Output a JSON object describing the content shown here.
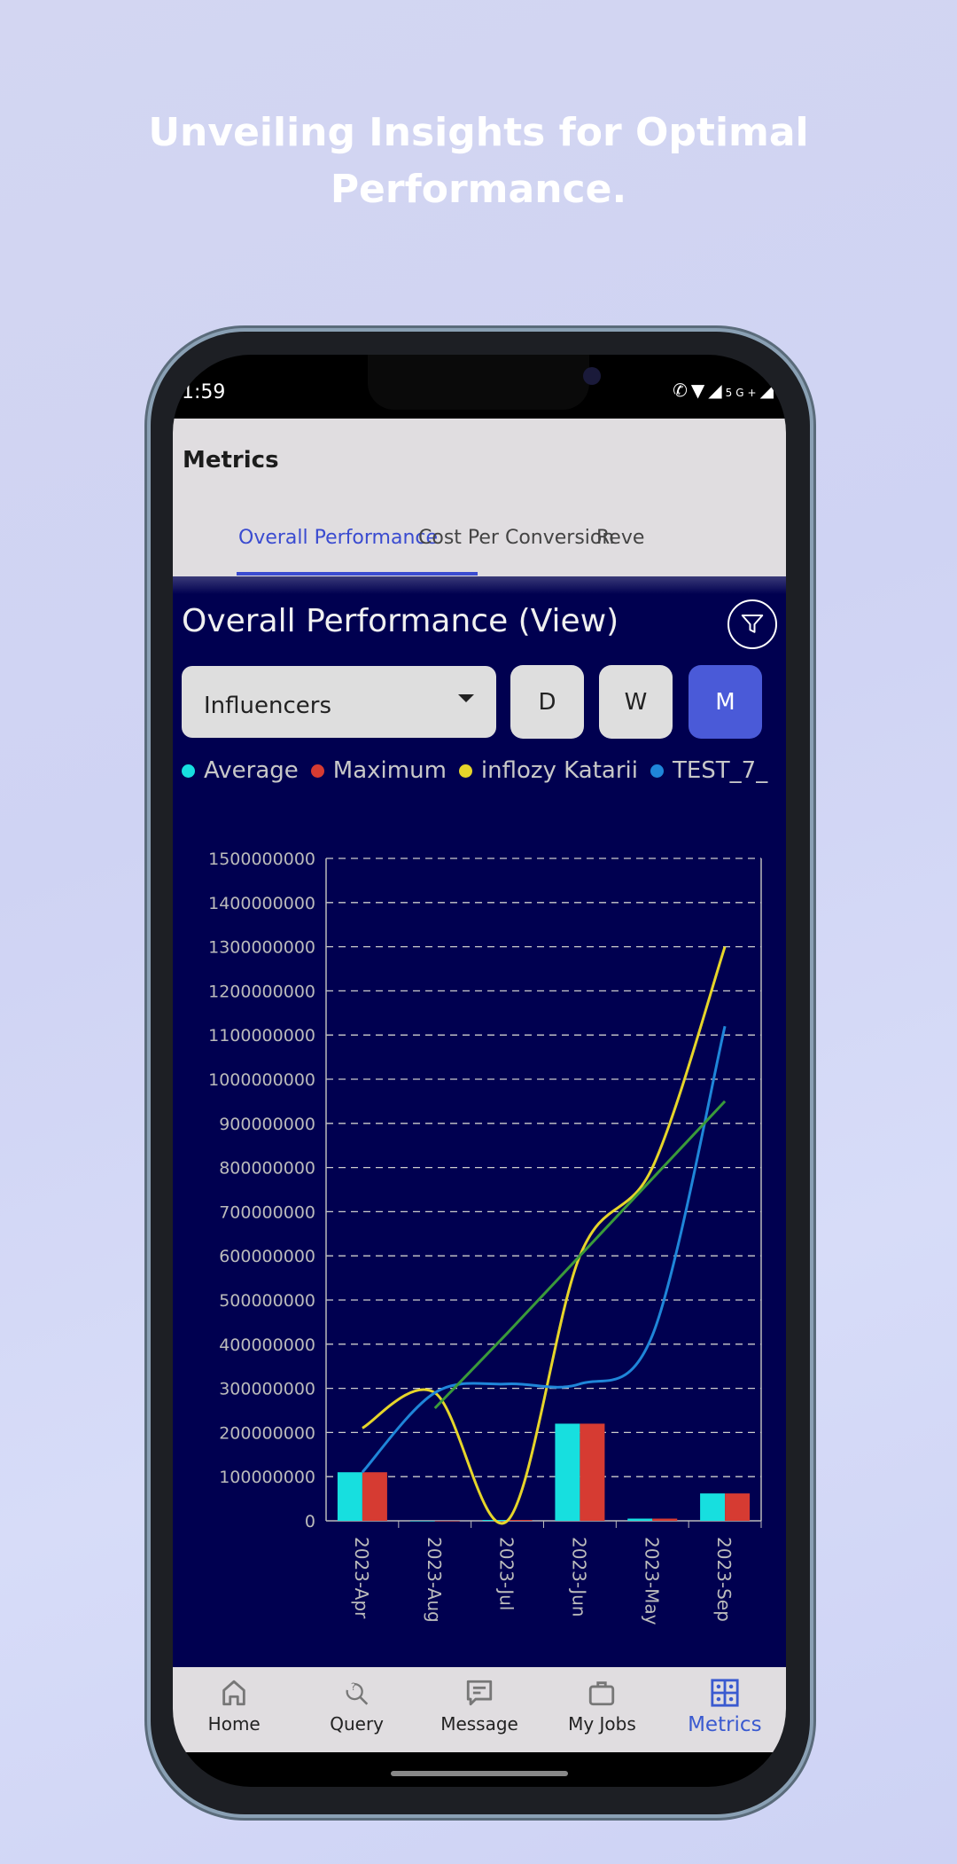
{
  "headline": {
    "line1": "Unveiling Insights for Optimal",
    "line2": "Performance."
  },
  "status": {
    "time": "1:59",
    "icons": [
      "wifi-call-icon",
      "wifi-icon",
      "signal-icon",
      "5g-icon",
      "signal-icon"
    ],
    "network": "5G+"
  },
  "appbar": {
    "title": "Metrics",
    "tabs": [
      {
        "label": "Overall Performance",
        "active": true
      },
      {
        "label": "Cost Per Conversion"
      },
      {
        "label": "Reve"
      }
    ]
  },
  "content": {
    "title": "Overall Performance (View)",
    "filter_icon": "filter-icon",
    "dropdown": {
      "value": "Influencers"
    },
    "periods": [
      {
        "label": "D"
      },
      {
        "label": "W"
      },
      {
        "label": "M",
        "active": true
      }
    ]
  },
  "colors": {
    "accent": "#4a5ad8",
    "background": "#000050",
    "average": "#17dfdf",
    "maximum": "#d63b32",
    "inflozy": "#e6d52a",
    "test": "#1f86d9",
    "trend": "#3a9a3a"
  },
  "chart_data": {
    "type": "bar+line",
    "categories": [
      "2023-Apr",
      "2023-Aug",
      "2023-Jul",
      "2023-Jun",
      "2023-May",
      "2023-Sep"
    ],
    "ylim": [
      0,
      1500000000
    ],
    "yticks": [
      "0",
      "100000000",
      "200000000",
      "300000000",
      "400000000",
      "500000000",
      "600000000",
      "700000000",
      "800000000",
      "900000000",
      "1000000000",
      "1100000000",
      "1200000000",
      "1300000000",
      "1400000000",
      "1500000000"
    ],
    "grid": "horizontal dashed",
    "legend": "top",
    "series": [
      {
        "name": "Average",
        "type": "bar",
        "color": "#17dfdf",
        "values": [
          110000000,
          0,
          2000000,
          220000000,
          5000000,
          62000000
        ]
      },
      {
        "name": "Maximum",
        "type": "bar",
        "color": "#d63b32",
        "values": [
          110000000,
          0,
          2000000,
          220000000,
          5000000,
          62000000
        ]
      },
      {
        "name": "inflozy Katarii",
        "type": "line",
        "color": "#e6d52a",
        "values": [
          210000000,
          290000000,
          0,
          600000000,
          800000000,
          1300000000
        ]
      },
      {
        "name": "TEST_7_",
        "type": "line",
        "color": "#1f86d9",
        "values": [
          110000000,
          290000000,
          310000000,
          310000000,
          420000000,
          1120000000
        ]
      },
      {
        "type": "line",
        "color": "#3a9a3a",
        "values": [
          null,
          255000000,
          425000000,
          600000000,
          775000000,
          950000000
        ]
      }
    ]
  },
  "nav": [
    {
      "label": "Home",
      "icon": "home-icon"
    },
    {
      "label": "Query",
      "icon": "query-icon"
    },
    {
      "label": "Message",
      "icon": "message-icon"
    },
    {
      "label": "My Jobs",
      "icon": "briefcase-icon"
    },
    {
      "label": "Metrics",
      "icon": "metrics-grid-icon",
      "active": true
    }
  ]
}
